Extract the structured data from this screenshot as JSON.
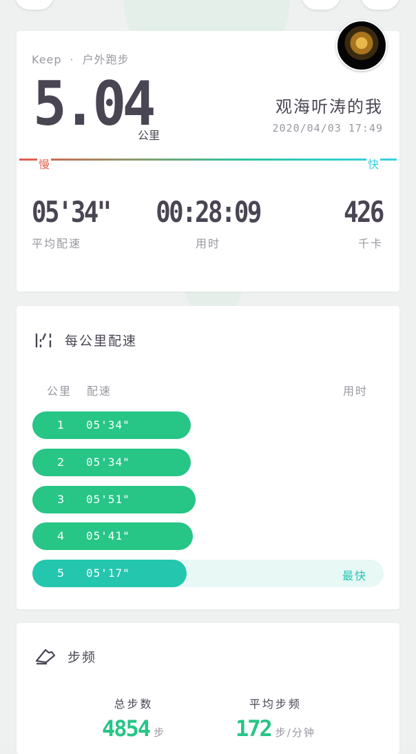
{
  "summary": {
    "app_name": "Keep",
    "separator": "·",
    "activity_type": "户外跑步",
    "distance": "5.04",
    "distance_unit": "公里",
    "username": "观海听涛的我",
    "datetime": "2020/04/03 17:49",
    "speed_slow_label": "慢",
    "speed_fast_label": "快",
    "stats": [
      {
        "value": "05'34\"",
        "label": "平均配速"
      },
      {
        "value": "00:28:09",
        "label": "用时"
      },
      {
        "value": "426",
        "label": "千卡"
      }
    ]
  },
  "pace_section": {
    "title": "每公里配速",
    "col_km": "公里",
    "col_pace": "配速",
    "col_time": "用时",
    "fastest_label": "最快",
    "rows": [
      {
        "km": "1",
        "pace": "05'34\""
      },
      {
        "km": "2",
        "pace": "05'34\""
      },
      {
        "km": "3",
        "pace": "05'51\""
      },
      {
        "km": "4",
        "pace": "05'41\""
      },
      {
        "km": "5",
        "pace": "05'17\""
      }
    ]
  },
  "cadence_section": {
    "title": "步频",
    "total_steps_label": "总步数",
    "total_steps_value": "4854",
    "total_steps_unit": "步",
    "avg_cadence_label": "平均步频",
    "avg_cadence_value": "172",
    "avg_cadence_unit": "步/分钟"
  },
  "colors": {
    "accent_green": "#27c586",
    "fastest_teal": "#24c6ae",
    "slow_red": "#e36552",
    "fast_cyan": "#38cfe0"
  }
}
